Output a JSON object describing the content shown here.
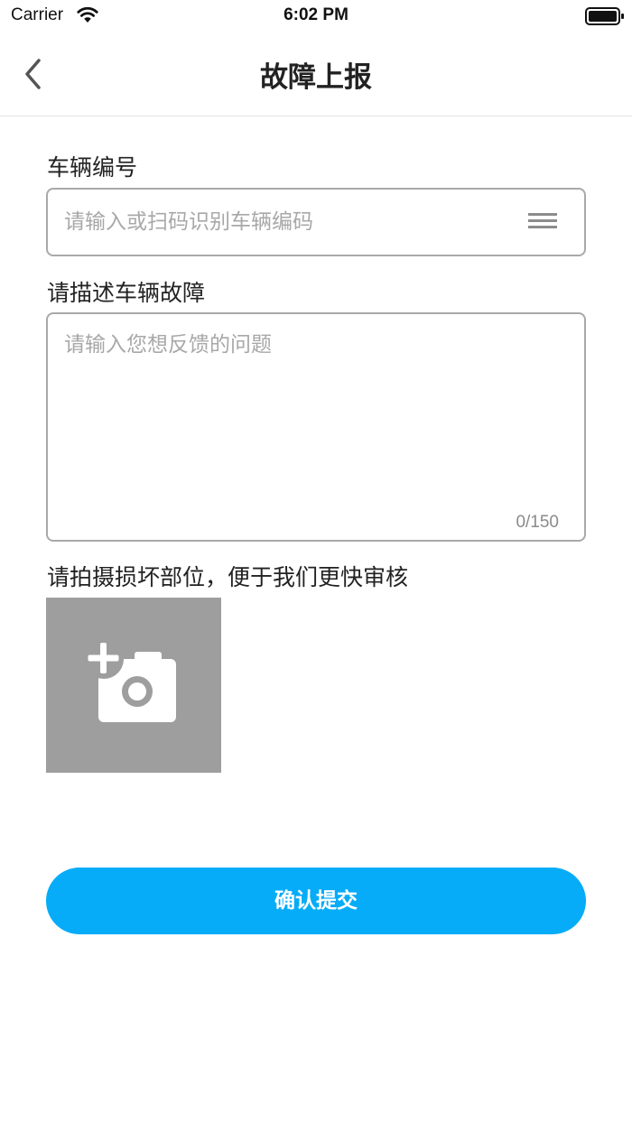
{
  "status_bar": {
    "carrier": "Carrier",
    "time": "6:02 PM",
    "wifi_icon": "wifi-icon",
    "battery_icon": "battery-full-icon"
  },
  "nav": {
    "title": "故障上报",
    "back_icon": "chevron-left-icon"
  },
  "vehicle": {
    "label": "车辆编号",
    "placeholder": "请输入或扫码识别车辆编码",
    "value": "",
    "scan_icon": "scan-icon"
  },
  "description": {
    "label": "请描述车辆故障",
    "placeholder": "请输入您想反馈的问题",
    "value": "",
    "counter": "0/150"
  },
  "photo": {
    "label": "请拍摄损坏部位，便于我们更快审核",
    "icon": "add-camera-icon"
  },
  "submit": {
    "label": "确认提交"
  },
  "colors": {
    "accent": "#06acf8",
    "upload_bg": "#9e9e9e",
    "border": "#a9a9a9"
  }
}
